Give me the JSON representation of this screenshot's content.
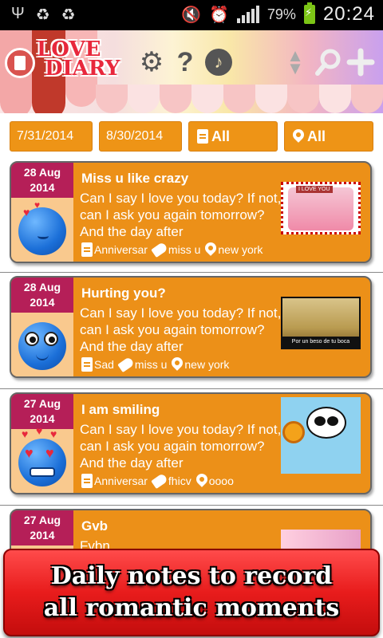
{
  "status_bar": {
    "battery_percent": "79%",
    "time": "20:24",
    "left_icons": [
      "usb-icon",
      "recycle-icon",
      "recycle-icon"
    ],
    "right_icons": [
      "mute-icon",
      "alarm-icon",
      "signal-icon",
      "battery-icon"
    ]
  },
  "header": {
    "logo_line1": "LOVE",
    "logo_line2": "DIARY",
    "icons": [
      "diary-icon",
      "gear-icon",
      "help-icon",
      "music-icon",
      "sort-icon",
      "search-icon",
      "add-icon"
    ]
  },
  "filters": {
    "start_date": "7/31/2014",
    "end_date": "8/30/2014",
    "category": "All",
    "location": "All"
  },
  "entries": [
    {
      "day": "28 Aug",
      "year": "2014",
      "title": "Miss u like crazy",
      "body": "Can I say I love you today? If not, can I ask you again tomorrow? And the day after",
      "category": "Anniversar",
      "tag": "miss u",
      "location": "new york",
      "thumbnail": "cake",
      "thumb_caption": "I LOVE YOU",
      "emoji": "kiss-emoji"
    },
    {
      "day": "28 Aug",
      "year": "2014",
      "title": "Hurting you?",
      "body": "Can I say I love you today? If not, can I ask you again tomorrow? And the day after",
      "category": "Sad",
      "tag": "miss u",
      "location": "new york",
      "thumbnail": "field",
      "thumb_caption": "Por un beso de tu boca",
      "emoji": "big-eyes-emoji"
    },
    {
      "day": "27 Aug",
      "year": "2014",
      "title": "I am smiling",
      "body": "Can I say I love you today? If not, can I ask you again tomorrow? And the day after",
      "category": "Anniversar",
      "tag": "fhicv",
      "location": "oooo",
      "thumbnail": "panda",
      "thumb_caption": "",
      "emoji": "heart-eyes-emoji"
    },
    {
      "day": "27 Aug",
      "year": "2014",
      "title": "Gvb",
      "body": "Fvbn",
      "category": "",
      "tag": "",
      "location": "",
      "thumbnail": "kitty",
      "thumb_caption": "",
      "emoji": "heart-emoji"
    }
  ],
  "banner": {
    "line1": "Daily notes to record",
    "line2": "all romantic moments"
  }
}
